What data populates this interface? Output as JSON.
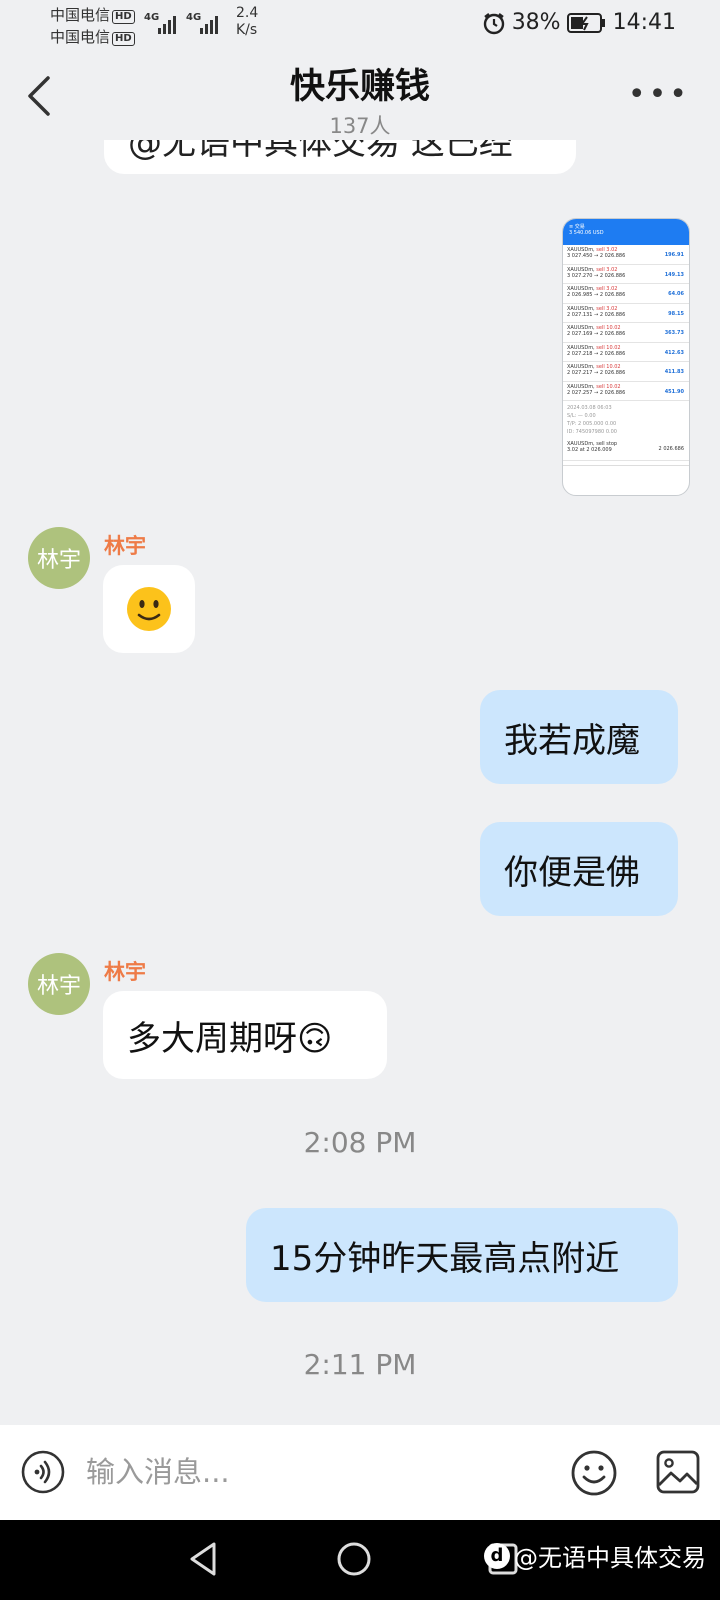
{
  "status_bar": {
    "carrier_1": "中国电信",
    "carrier_2": "中国电信",
    "hd_badge": "HD",
    "network": "4G",
    "speed_value": "2.4",
    "speed_unit": "K/s",
    "battery": "38%",
    "time": "14:41"
  },
  "header": {
    "title": "快乐赚钱",
    "member_count": "137人"
  },
  "messages": {
    "clipped_text": "@无语中具体交易 这已经",
    "m1_sender": "林宇",
    "m1_avatar": "林宇",
    "m1_text": "🙂",
    "m2_text": "我若成魔",
    "m3_text": "你便是佛",
    "m4_sender": "林宇",
    "m4_avatar": "林宇",
    "m4_text": "多大周期呀🙃",
    "time_1": "2:08 PM",
    "m5_text": "15分钟昨天最高点附近",
    "time_2": "2:11 PM"
  },
  "thumbnail": {
    "balance": "3 540.06 USD",
    "rows": [
      {
        "sym": "XAUUSDm,",
        "act": "sell 3.02",
        "price": "3 027.450 → 2 026.886",
        "pnl": "196.91"
      },
      {
        "sym": "XAUUSDm,",
        "act": "sell 3.02",
        "price": "3 027.270 → 2 026.886",
        "pnl": "149.13"
      },
      {
        "sym": "XAUUSDm,",
        "act": "sell 3.02",
        "price": "2 026.985 → 2 026.886",
        "pnl": "64.06"
      },
      {
        "sym": "XAUUSDm,",
        "act": "sell 3.02",
        "price": "2 027.131 → 2 026.886",
        "pnl": "98.15"
      },
      {
        "sym": "XAUUSDm,",
        "act": "sell 10.02",
        "price": "2 027.169 → 2 026.886",
        "pnl": "363.73"
      },
      {
        "sym": "XAUUSDm,",
        "act": "sell 10.02",
        "price": "2 027.218 → 2 026.886",
        "pnl": "412.63"
      },
      {
        "sym": "XAUUSDm,",
        "act": "sell 10.02",
        "price": "2 027.217 → 2 026.886",
        "pnl": "411.83"
      },
      {
        "sym": "XAUUSDm,",
        "act": "sell 10.02",
        "price": "2 027.257 → 2 026.886",
        "pnl": "451.90"
      }
    ],
    "pending": "XAUUSDm, sell stop",
    "pending_detail": "3.02 at 2 026.009",
    "pending_price": "2 026.686"
  },
  "input_bar": {
    "placeholder": "输入消息..."
  },
  "watermark": {
    "text": "@无语中具体交易"
  },
  "icons": {
    "back": "chevron-left-icon",
    "more": "more-dots-icon",
    "voice": "voice-icon",
    "emoji": "smiley-icon",
    "image": "image-icon",
    "alarm": "alarm-icon",
    "battery": "battery-icon"
  },
  "colors": {
    "outgoing_bubble": "#cce6fd",
    "incoming_bubble": "#ffffff",
    "sender_name": "#ee7b47",
    "avatar_bg": "#aec27d",
    "background": "#eff0f2"
  }
}
